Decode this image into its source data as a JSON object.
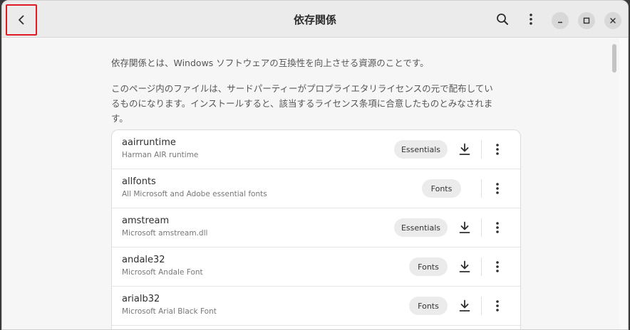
{
  "header": {
    "title": "依存関係"
  },
  "description": {
    "line1": "依存関係とは、Windows ソフトウェアの互換性を向上させる資源のことです。",
    "line2a": "このページ内のファイルは、サードパーティーがプロプライエタリライセンスの元で配布してい",
    "line2b": "るものになります。インストールすると、該当するライセンス条項に合意したものとみなされま",
    "line2c": "す。"
  },
  "dependencies": [
    {
      "name": "aairruntime",
      "description": "Harman AIR runtime",
      "category": "Essentials",
      "installable": true
    },
    {
      "name": "allfonts",
      "description": "All Microsoft and Adobe essential fonts",
      "category": "Fonts",
      "installable": false
    },
    {
      "name": "amstream",
      "description": "Microsoft amstream.dll",
      "category": "Essentials",
      "installable": true
    },
    {
      "name": "andale32",
      "description": "Microsoft Andale Font",
      "category": "Fonts",
      "installable": true
    },
    {
      "name": "arialb32",
      "description": "Microsoft Arial Black Font",
      "category": "Fonts",
      "installable": true
    }
  ],
  "icons": {
    "back": "chevron-left-icon",
    "search": "search-icon",
    "menu": "vertical-dots-icon",
    "minimize": "minimize-icon",
    "maximize": "maximize-icon",
    "close": "close-icon",
    "download": "download-icon"
  },
  "colors": {
    "highlight": "#e01b24",
    "badge_bg": "#ebebeb"
  }
}
